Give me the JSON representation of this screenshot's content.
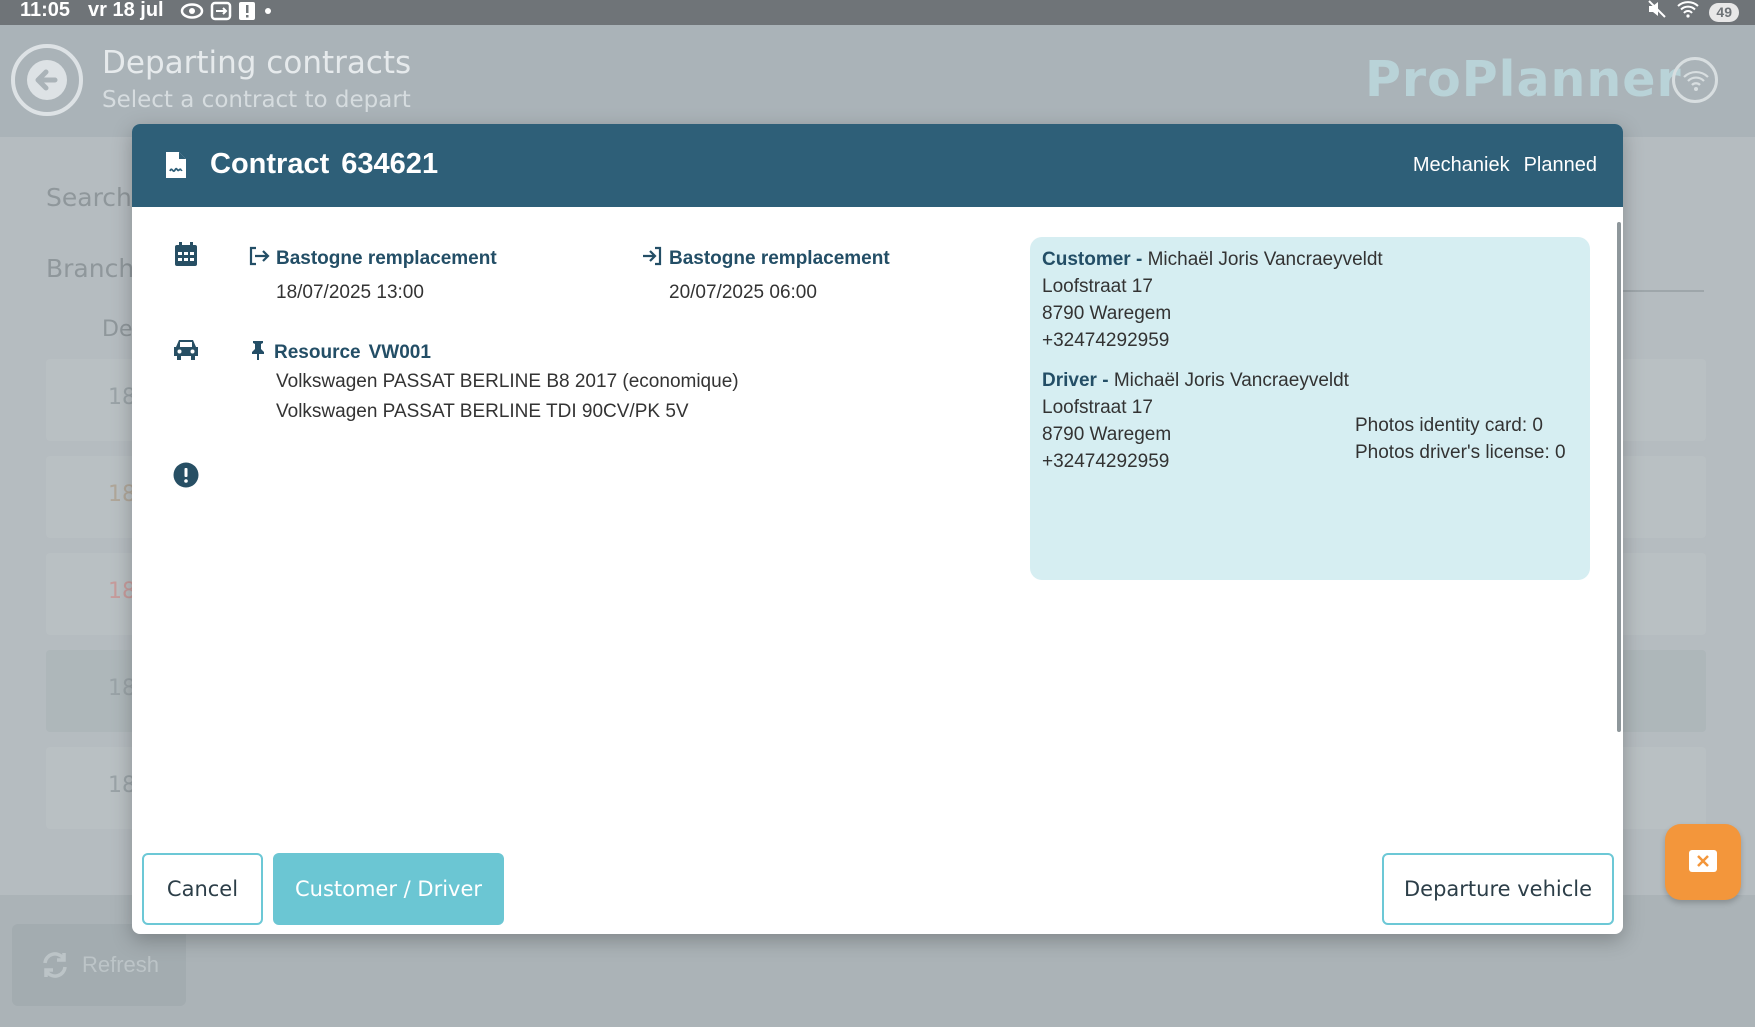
{
  "status_bar": {
    "time": "11:05",
    "date": "vr 18 jul",
    "battery": "49",
    "icons": [
      "eye-icon",
      "cast-icon",
      "alert-icon",
      "dot-icon",
      "mute-icon",
      "wifi-icon"
    ]
  },
  "background": {
    "title": "Departing contracts",
    "subtitle": "Select a contract to depart",
    "brand": "ProPlanner",
    "search_label": "Search",
    "branch_label": "Branch",
    "column_fragment": "De",
    "row_fragments": [
      "18",
      "18",
      "18",
      "18",
      "18"
    ],
    "refresh_label": "Refresh"
  },
  "modal": {
    "title_prefix": "Contract",
    "contract_number": "634621",
    "header_meta": [
      "Mechaniek",
      "Planned"
    ],
    "departure": {
      "location": "Bastogne remplacement",
      "datetime": "18/07/2025 13:00"
    },
    "return": {
      "location": "Bastogne remplacement",
      "datetime": "20/07/2025 06:00"
    },
    "resource": {
      "label": "Resource",
      "code": "VW001",
      "lines": [
        "Volkswagen PASSAT BERLINE B8 2017 (economique)",
        "Volkswagen PASSAT BERLINE TDI 90CV/PK 5V"
      ]
    },
    "customer": {
      "role": "Customer -",
      "name": "Michaël Joris Vancraeyveldt",
      "street": "Loofstraat 17",
      "city": "8790 Waregem",
      "phone": "+32474292959"
    },
    "driver": {
      "role": "Driver -",
      "name": "Michaël Joris Vancraeyveldt",
      "street": "Loofstraat 17",
      "city": "8790 Waregem",
      "phone": "+32474292959"
    },
    "photos": {
      "identity_card": "Photos identity card: 0",
      "drivers_license": "Photos driver's license: 0"
    },
    "buttons": {
      "cancel": "Cancel",
      "customer_driver": "Customer / Driver",
      "departure": "Departure vehicle"
    }
  },
  "colors": {
    "header": "#2e5f78",
    "accent": "#6bc6d3",
    "panel": "#d6eef2",
    "fab": "#f3963b"
  }
}
